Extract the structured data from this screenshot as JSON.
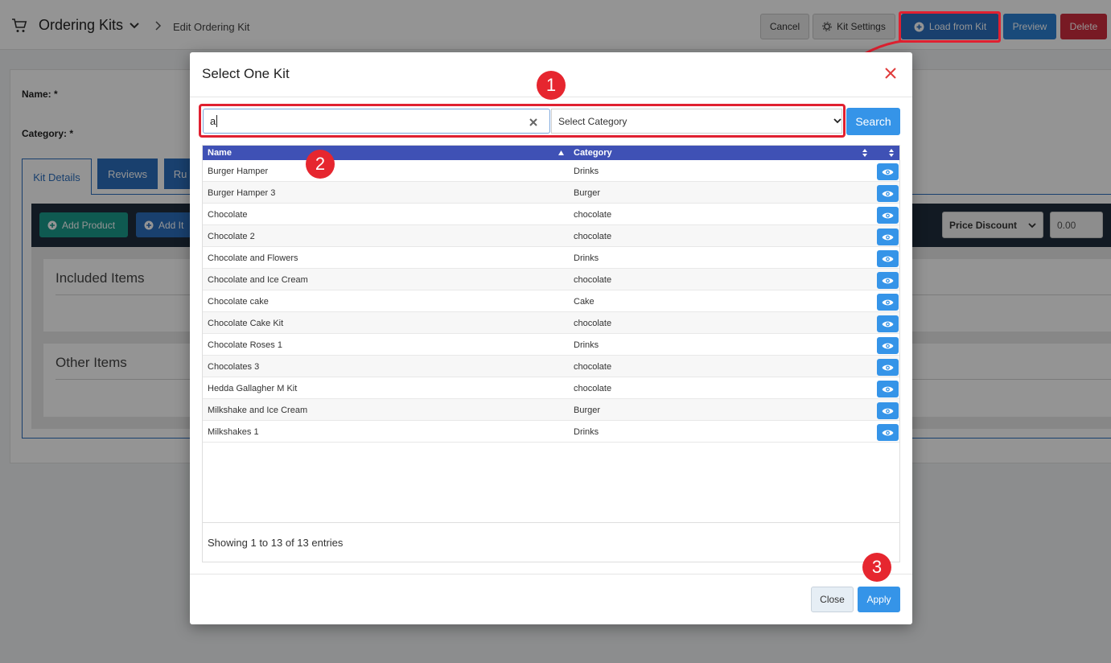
{
  "header": {
    "app_title": "Ordering Kits",
    "breadcrumb": "Edit Ordering Kit",
    "cancel_label": "Cancel",
    "kit_settings_label": "Kit Settings",
    "load_from_kit_label": "Load from Kit",
    "preview_label": "Preview",
    "delete_label": "Delete"
  },
  "form": {
    "name_label": "Name: *",
    "category_label": "Category: *"
  },
  "tabs": [
    "Kit Details",
    "Reviews",
    "Ru"
  ],
  "toolbar": {
    "add_product_label": "Add Product",
    "add_item_label": "Add It",
    "price_discount_label": "Price Discount",
    "discount_value": "0.00"
  },
  "sections": {
    "included_items": "Included Items",
    "other_items": "Other Items"
  },
  "modal": {
    "title": "Select One Kit",
    "search_value": "a",
    "category_placeholder": "Select Category",
    "search_button": "Search",
    "columns": {
      "name": "Name",
      "category": "Category"
    },
    "rows": [
      {
        "name": "Burger Hamper",
        "category": "Drinks"
      },
      {
        "name": "Burger Hamper 3",
        "category": "Burger"
      },
      {
        "name": "Chocolate",
        "category": "chocolate"
      },
      {
        "name": "Chocolate 2",
        "category": "chocolate"
      },
      {
        "name": "Chocolate and Flowers",
        "category": "Drinks"
      },
      {
        "name": "Chocolate and Ice Cream",
        "category": "chocolate"
      },
      {
        "name": "Chocolate cake",
        "category": "Cake"
      },
      {
        "name": "Chocolate Cake Kit",
        "category": "chocolate"
      },
      {
        "name": "Chocolate Roses 1",
        "category": "Drinks"
      },
      {
        "name": "Chocolates 3",
        "category": "chocolate"
      },
      {
        "name": "Hedda Gallagher M Kit",
        "category": "chocolate"
      },
      {
        "name": "Milkshake and Ice Cream",
        "category": "Burger"
      },
      {
        "name": "Milkshakes 1",
        "category": "Drinks"
      }
    ],
    "entries_text": "Showing 1 to 13 of 13 entries",
    "close_label": "Close",
    "apply_label": "Apply"
  },
  "annotations": {
    "step1": "1",
    "step2": "2",
    "step3": "3",
    "highlight_color": "#e02030"
  }
}
